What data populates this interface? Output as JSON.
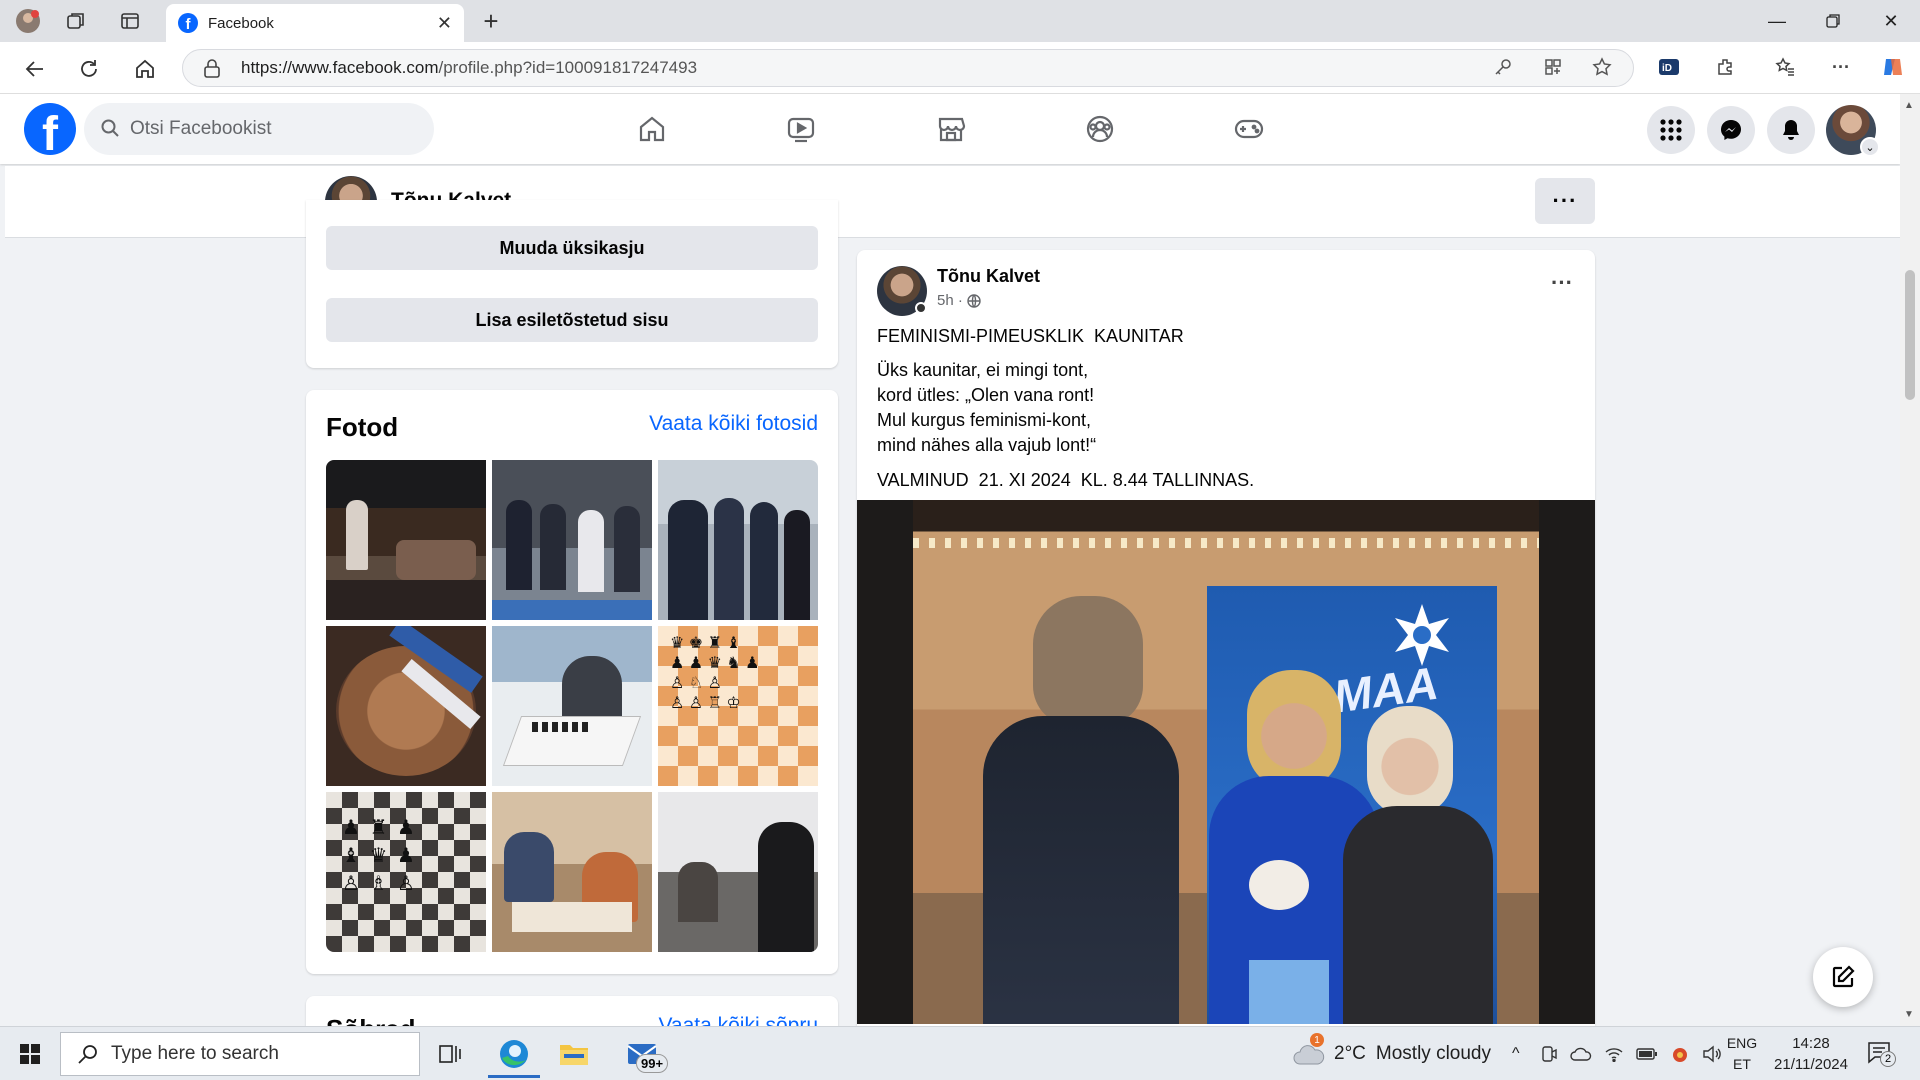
{
  "browser": {
    "tab_title": "Facebook",
    "url_host": "https://www.facebook.com",
    "url_path": "/profile.php?id=100091817247493"
  },
  "fb": {
    "logo": "f",
    "search_placeholder": "Otsi Facebookist",
    "nav_icons": [
      "home-icon",
      "video-icon",
      "marketplace-icon",
      "groups-icon",
      "gaming-icon"
    ],
    "brand_color": "#0866ff"
  },
  "profile": {
    "name": "Tõnu Kalvet",
    "more": "···"
  },
  "left": {
    "edit_details": "Muuda üksikasju",
    "add_featured": "Lisa esiletõstetud sisu",
    "photos_title": "Fotod",
    "photos_link": "Vaata kõiki fotosid",
    "friends_title": "Sõbrad",
    "friends_link": "Vaata kõiki sõpru"
  },
  "post": {
    "author": "Tõnu Kalvet",
    "time": "5h ·",
    "title": "FEMINISMI-PIMEUSKLIK  KAUNITAR",
    "lines": [
      "Üks kaunitar, ei mingi tont,",
      "kord ütles: „Olen vana ront!",
      "Mul kurgus feminismi-kont,",
      "mind nähes alla vajub lont!“"
    ],
    "footer": "VALMINUD  21. XI 2024  KL. 8.44 TALLINNAS.",
    "banner_text": "ISAMAA"
  },
  "taskbar": {
    "search_placeholder": "Type here to search",
    "mail_badge": "99+",
    "weather_temp": "2°C",
    "weather_desc": "Mostly cloudy",
    "weather_alert": "1",
    "lang_top": "ENG",
    "lang_bottom": "ET",
    "time": "14:28",
    "date": "21/11/2024",
    "notif_count": "2"
  }
}
